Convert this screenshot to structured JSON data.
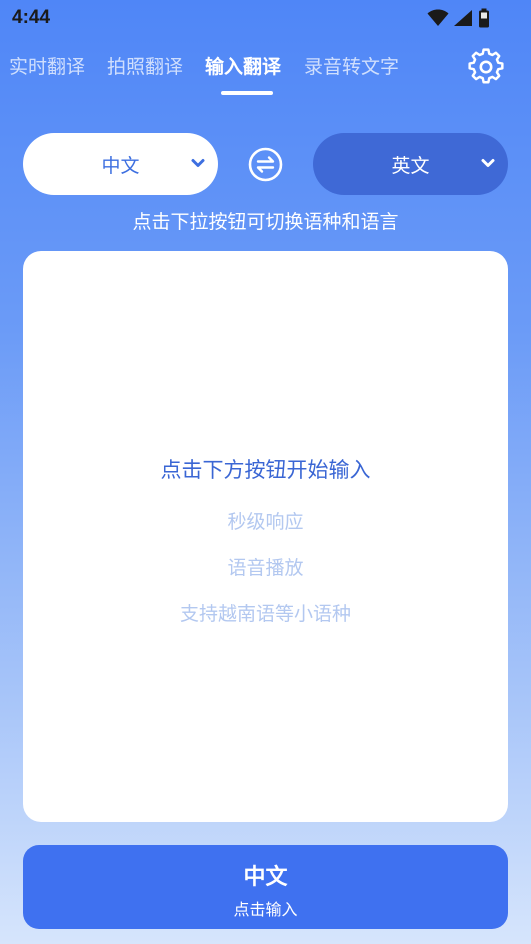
{
  "status_bar": {
    "time": "4:44",
    "icons": [
      "wifi-icon",
      "signal-icon",
      "battery-icon"
    ]
  },
  "tabs": [
    {
      "label": "实时翻译",
      "active": false
    },
    {
      "label": "拍照翻译",
      "active": false
    },
    {
      "label": "输入翻译",
      "active": true
    },
    {
      "label": "录音转文字",
      "active": false
    }
  ],
  "settings": {
    "icon": "gear-icon"
  },
  "language": {
    "source": "中文",
    "target": "英文",
    "swap_icon": "swap-icon",
    "dropdown_icon": "chevron-down-icon",
    "hint": "点击下拉按钮可切换语种和语言"
  },
  "card": {
    "title": "点击下方按钮开始输入",
    "features": [
      "秒级响应",
      "语音播放",
      "支持越南语等小语种"
    ]
  },
  "input_button": {
    "language": "中文",
    "action": "点击输入"
  },
  "colors": {
    "accent": "#3f71f0",
    "target_pill": "#3f69d6",
    "card_title": "#3a66d4",
    "card_feature": "#b3c8f0",
    "background_top": "#4f86f7",
    "background_bottom": "#d6e5fc"
  }
}
